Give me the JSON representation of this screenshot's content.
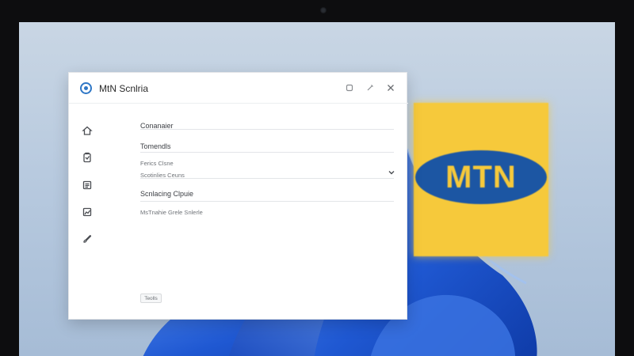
{
  "window": {
    "title": "MtN Scnlria",
    "controls": {
      "pin_icon": "pin-icon",
      "pen_icon": "edit-icon",
      "close_icon": "close-icon"
    }
  },
  "sidebar": {
    "icons": [
      "home-icon",
      "clipboard-icon",
      "list-icon",
      "chart-icon",
      "brush-icon"
    ]
  },
  "form": {
    "field1_label": "Conanaier",
    "field2_label": "Tomendls",
    "field3_label": "Ferics Clsne",
    "field3_sub": "Scotinlies Ceuns",
    "field4_label": "Scnlacing Clpuie",
    "field4_sub": "MsTnahie Grele Snlerle",
    "button_label": "Teolls"
  },
  "desktop": {
    "tile_text": "MTN",
    "colors": {
      "accent_blue": "#1c56a3",
      "mtn_yellow": "#f6c93b",
      "bloom_blue": "#2a64d6"
    }
  }
}
